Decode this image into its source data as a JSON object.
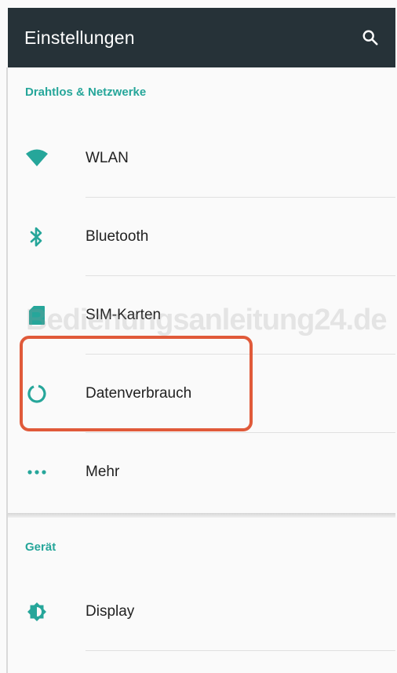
{
  "appbar": {
    "title": "Einstellungen",
    "search_icon": "search-icon"
  },
  "sections": [
    {
      "header": "Drahtlos & Netzwerke",
      "items": [
        {
          "label": "WLAN",
          "icon": "wifi-icon"
        },
        {
          "label": "Bluetooth",
          "icon": "bluetooth-icon"
        },
        {
          "label": "SIM-Karten",
          "icon": "sim-card-icon"
        },
        {
          "label": "Datenverbrauch",
          "icon": "data-usage-icon"
        },
        {
          "label": "Mehr",
          "icon": "more-dots-icon"
        }
      ]
    },
    {
      "header": "Gerät",
      "items": [
        {
          "label": "Display",
          "icon": "display-brightness-icon"
        }
      ]
    }
  ],
  "watermark": "Bedienungsanleitung24.de",
  "colors": {
    "appbar": "#263238",
    "accent": "#26a69a",
    "highlight": "#e05a3a"
  }
}
